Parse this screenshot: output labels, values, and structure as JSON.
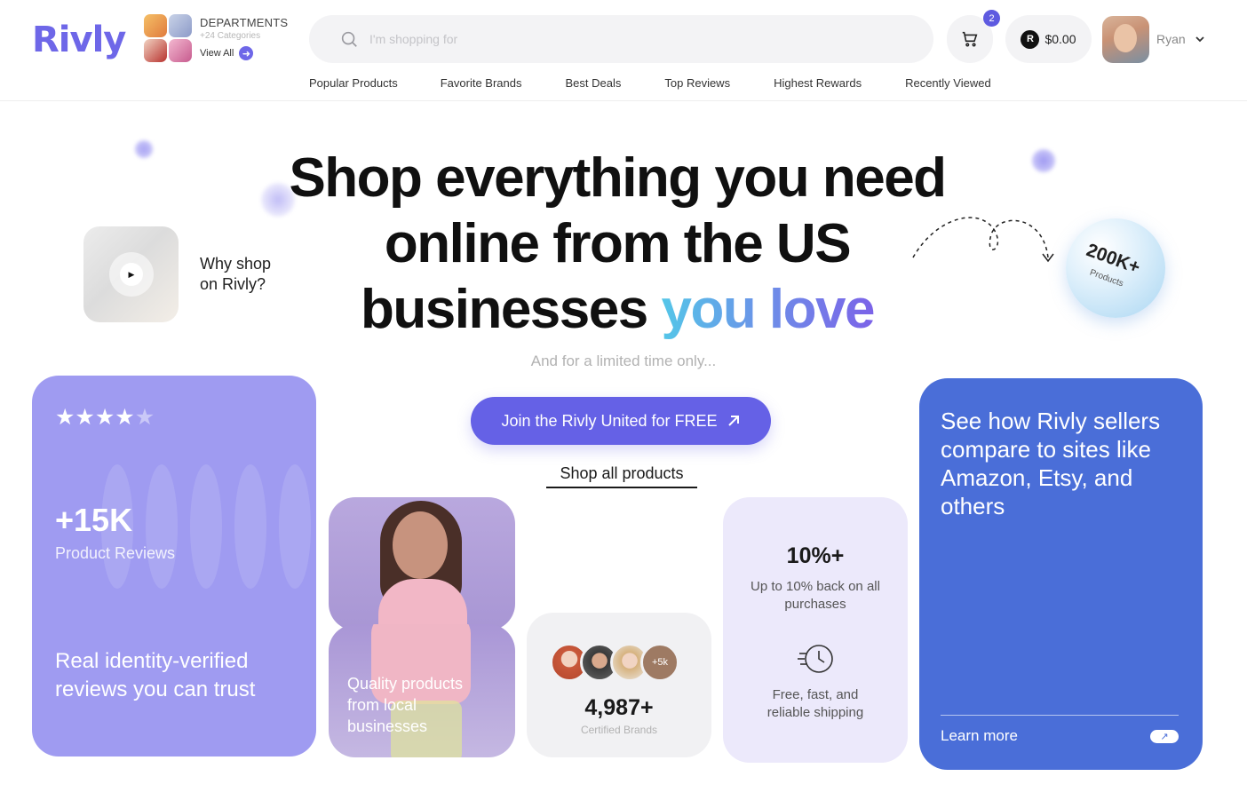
{
  "brand": {
    "logo": "Rivly"
  },
  "departments": {
    "title": "DEPARTMENTS",
    "subtitle": "+24 Categories",
    "view_all": "View All"
  },
  "search": {
    "placeholder": "I'm shopping for"
  },
  "cart": {
    "count": "2"
  },
  "wallet": {
    "coin_letter": "R",
    "balance": "$0.00"
  },
  "user": {
    "name": "Ryan"
  },
  "nav": {
    "items": [
      "Popular Products",
      "Favorite Brands",
      "Best Deals",
      "Top Reviews",
      "Highest Rewards",
      "Recently Viewed"
    ]
  },
  "hero": {
    "line1": "Shop everything you need",
    "line2": "online from the US",
    "line3_plain": "businesses",
    "line3_highlight": "you love",
    "subtitle": "And for a limited time only...",
    "cta": "Join the Rivly United for FREE",
    "shop_all": "Shop all products"
  },
  "why": {
    "text": "Why shop on Rivly?"
  },
  "products_badge": {
    "value": "200K+",
    "label": "Products"
  },
  "reviews_card": {
    "rating": 4,
    "rating_max": 5,
    "count": "+15K",
    "label": "Product Reviews",
    "tagline": "Real identity-verified reviews you can trust"
  },
  "quality_card": {
    "text": "Quality products from local businesses"
  },
  "brands_card": {
    "extra_badge": "+5k",
    "count": "4,987+",
    "label": "Certified Brands"
  },
  "rewards_card": {
    "percent": "10%+",
    "percent_text": "Up to 10% back on all purchases",
    "shipping_text": "Free, fast, and reliable shipping"
  },
  "compare_card": {
    "title": "See how Rivly sellers compare to sites like Amazon, Etsy, and others",
    "link": "Learn more"
  },
  "colors": {
    "accent": "#6561e6",
    "compare_blue": "#4a6ed8",
    "reviews_purple": "#9f9bf1",
    "rewards_lilac": "#ece9fb"
  },
  "icons": [
    "search-icon",
    "cart-icon",
    "chevron-down-icon",
    "arrow-right-icon",
    "play-icon",
    "star-icon",
    "arrow-up-right-icon",
    "fast-shipping-icon",
    "dashed-curve-arrow"
  ]
}
